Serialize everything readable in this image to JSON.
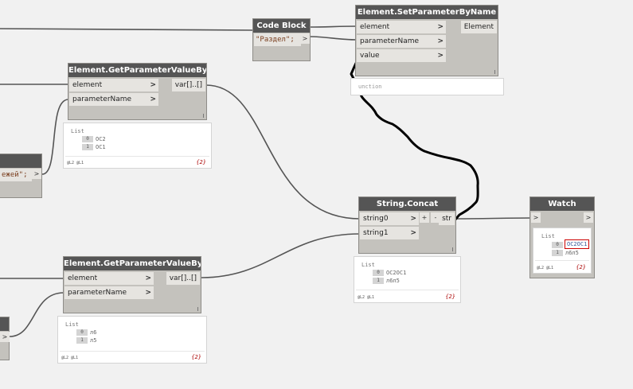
{
  "nodes": {
    "code_block_top": {
      "title": "Code Block",
      "code": "\"Раздел\";",
      "port_out": ">"
    },
    "set_param": {
      "title": "Element.SetParameterByName",
      "inputs": [
        "element",
        "parameterName",
        "value"
      ],
      "output": "Element",
      "arrow": ">",
      "preview_text": "unction"
    },
    "get_param_1": {
      "title": "Element.GetParameterValueByName",
      "inputs": [
        "element",
        "parameterName"
      ],
      "output": "var[]..[]",
      "arrow": ">"
    },
    "get_param_2": {
      "title": "Element.GetParameterValueByName",
      "inputs": [
        "element",
        "parameterName"
      ],
      "output": "var[]..[]",
      "arrow": ">"
    },
    "code_block_left": {
      "code": "ежей\";",
      "port_out": ">"
    },
    "code_block_left_low": {
      "port_out": ">"
    },
    "string_concat": {
      "title": "String.Concat",
      "inputs": [
        "string0",
        "string1"
      ],
      "output": "str",
      "plus": "+",
      "minus": "-",
      "arrow": ">"
    },
    "watch": {
      "title": "Watch",
      "port_in": ">",
      "port_out": ">"
    }
  },
  "previews": {
    "get_param_1": {
      "label": "List",
      "items": [
        {
          "index": "0",
          "value": "ОС2"
        },
        {
          "index": "1",
          "value": "ОС1"
        }
      ],
      "levels": "@L2 @L1",
      "count": "{2}"
    },
    "get_param_2": {
      "label": "List",
      "items": [
        {
          "index": "0",
          "value": "л6"
        },
        {
          "index": "1",
          "value": "л5"
        }
      ],
      "levels": "@L2 @L1",
      "count": "{2}"
    },
    "string_concat": {
      "label": "List",
      "items": [
        {
          "index": "0",
          "value": "ОС2ОС1"
        },
        {
          "index": "1",
          "value": "л6л5"
        }
      ],
      "levels": "@L2 @L1",
      "count": "{2}"
    },
    "watch": {
      "label": "List",
      "items": [
        {
          "index": "0",
          "value": "ОС2ОС1"
        },
        {
          "index": "1",
          "value": "л6л5"
        }
      ],
      "levels": "@L2 @L1",
      "count": "{2}"
    }
  },
  "colors": {
    "canvas": "#f1f1f1",
    "node_body": "#c4c2bd",
    "node_header": "#555555",
    "wire": "#555555",
    "drawn_wire": "#000000",
    "highlight": "#cc0000"
  }
}
